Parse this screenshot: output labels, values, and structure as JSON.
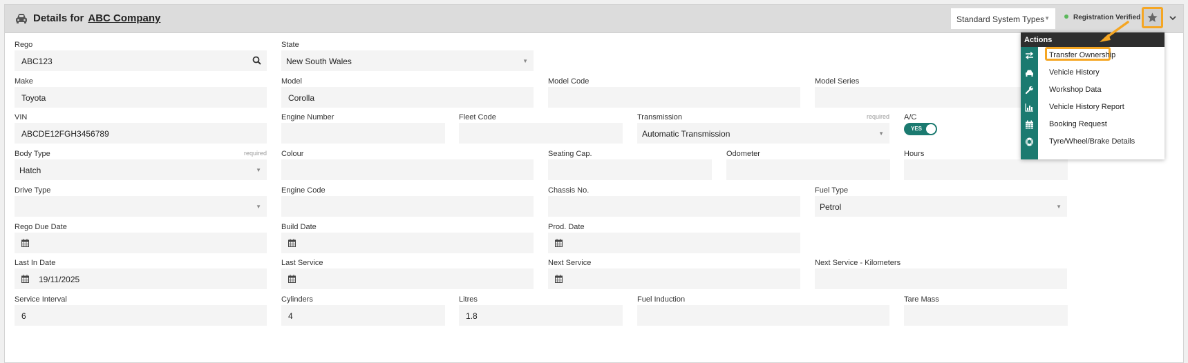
{
  "header": {
    "title_prefix": "Details for",
    "company": "ABC Company",
    "system_types": "Standard System Types",
    "verified_label": "Registration Verified"
  },
  "colors": {
    "accent_teal": "#1b7a70",
    "highlight_orange": "#f5a623",
    "verified_green": "#5bb85b",
    "header_bg": "#dcdcdc",
    "field_bg": "#f4f4f4"
  },
  "icons": {
    "header": "car-icon",
    "search": "search-icon",
    "date": "calendar-icon",
    "star": "star-icon",
    "menu": "chevron-down-icon",
    "select": "dropdown-caret"
  },
  "fields": {
    "rego": {
      "label": "Rego",
      "value": "ABC123"
    },
    "state": {
      "label": "State",
      "value": "New South Wales"
    },
    "make": {
      "label": "Make",
      "value": "Toyota"
    },
    "model": {
      "label": "Model",
      "value": "Corolla"
    },
    "model_code": {
      "label": "Model Code",
      "value": ""
    },
    "model_series": {
      "label": "Model Series",
      "value": ""
    },
    "vin": {
      "label": "VIN",
      "value": "ABCDE12FGH3456789"
    },
    "engine_number": {
      "label": "Engine Number",
      "value": ""
    },
    "fleet_code": {
      "label": "Fleet Code",
      "value": ""
    },
    "transmission": {
      "label": "Transmission",
      "required": "required",
      "value": "Automatic Transmission"
    },
    "ac": {
      "label": "A/C",
      "toggle_text": "YES",
      "on": true
    },
    "body_type": {
      "label": "Body Type",
      "required": "required",
      "value": "Hatch"
    },
    "colour": {
      "label": "Colour",
      "value": ""
    },
    "seating_cap": {
      "label": "Seating Cap.",
      "value": ""
    },
    "odometer": {
      "label": "Odometer",
      "value": ""
    },
    "hours": {
      "label": "Hours",
      "value": ""
    },
    "drive_type": {
      "label": "Drive Type",
      "value": ""
    },
    "engine_code": {
      "label": "Engine Code",
      "value": ""
    },
    "chassis_no": {
      "label": "Chassis No.",
      "value": ""
    },
    "fuel_type": {
      "label": "Fuel Type",
      "value": "Petrol"
    },
    "rego_due_date": {
      "label": "Rego Due Date",
      "value": ""
    },
    "build_date": {
      "label": "Build Date",
      "value": ""
    },
    "prod_date": {
      "label": "Prod. Date",
      "value": ""
    },
    "last_in_date": {
      "label": "Last In Date",
      "value": "19/11/2025"
    },
    "last_service": {
      "label": "Last Service",
      "value": ""
    },
    "next_service": {
      "label": "Next Service",
      "value": ""
    },
    "next_service_km": {
      "label": "Next Service - Kilometers",
      "value": ""
    },
    "service_interval": {
      "label": "Service Interval",
      "value": "6"
    },
    "cylinders": {
      "label": "Cylinders",
      "value": "4"
    },
    "litres": {
      "label": "Litres",
      "value": "1.8"
    },
    "fuel_induction": {
      "label": "Fuel Induction",
      "value": ""
    },
    "tare_mass": {
      "label": "Tare Mass",
      "value": ""
    }
  },
  "actions_menu": {
    "title": "Actions",
    "items": [
      {
        "label": "Transfer Ownership",
        "icon": "transfer-icon",
        "highlighted": true
      },
      {
        "label": "Vehicle History",
        "icon": "car-icon"
      },
      {
        "label": "Workshop Data",
        "icon": "wrench-icon"
      },
      {
        "label": "Vehicle History Report",
        "icon": "bar-chart-icon"
      },
      {
        "label": "Booking Request",
        "icon": "calendar-icon"
      },
      {
        "label": "Tyre/Wheel/Brake Details",
        "icon": "tyre-icon"
      }
    ]
  }
}
